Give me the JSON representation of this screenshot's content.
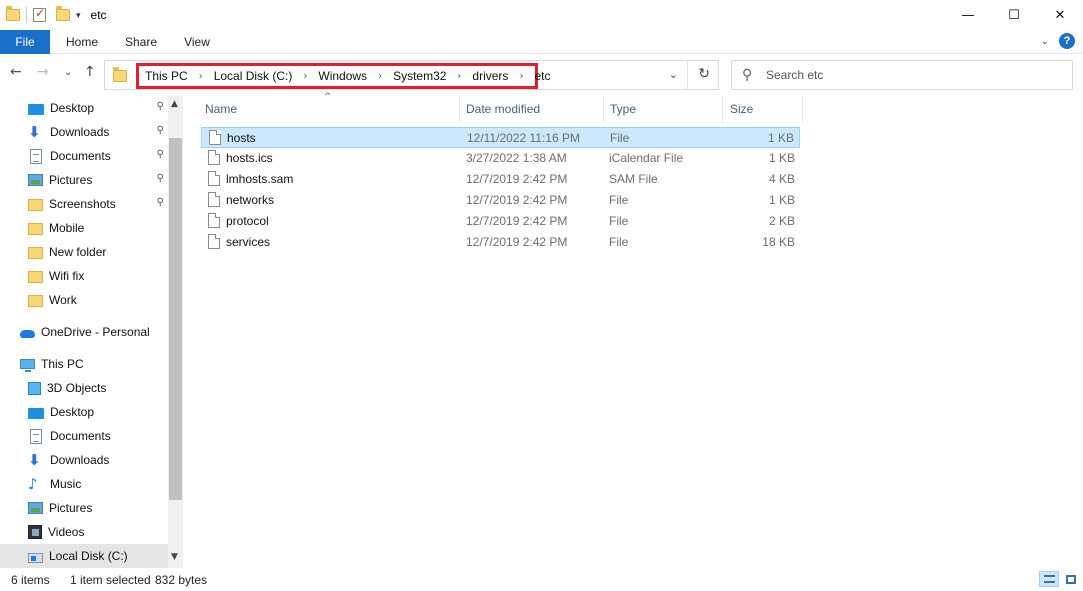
{
  "window": {
    "title": "etc",
    "controls": {
      "minimize": "—",
      "maximize": "☐",
      "close": "✕"
    }
  },
  "ribbon": {
    "tabs": [
      {
        "label": "File"
      },
      {
        "label": "Home"
      },
      {
        "label": "Share"
      },
      {
        "label": "View"
      }
    ],
    "collapse_glyph": "⌄",
    "help_glyph": "?"
  },
  "nav": {
    "back": "←",
    "forward": "→",
    "recent": "⌄",
    "up": "↑",
    "breadcrumbs": [
      "This PC",
      "Local Disk (C:)",
      "Windows",
      "System32",
      "drivers",
      "etc"
    ],
    "crumb_separator": "›",
    "address_dropdown": "⌄",
    "refresh": "↻",
    "highlight_color": "#e0202e"
  },
  "search": {
    "placeholder": "Search etc",
    "value": ""
  },
  "sidebar": {
    "items": [
      {
        "label": "Desktop",
        "icon": "desktop-icon",
        "pinned": true
      },
      {
        "label": "Downloads",
        "icon": "download-icon",
        "pinned": true
      },
      {
        "label": "Documents",
        "icon": "documents-icon",
        "pinned": true
      },
      {
        "label": "Pictures",
        "icon": "pictures-icon",
        "pinned": true
      },
      {
        "label": "Screenshots",
        "icon": "folder-icon",
        "pinned": true
      },
      {
        "label": "Mobile",
        "icon": "folder-icon",
        "pinned": false
      },
      {
        "label": "New folder",
        "icon": "folder-icon",
        "pinned": false
      },
      {
        "label": "Wifi fix",
        "icon": "folder-icon",
        "pinned": false
      },
      {
        "label": "Work",
        "icon": "folder-icon",
        "pinned": false
      },
      {
        "label": "OneDrive - Personal",
        "icon": "onedrive-icon",
        "pinned": false
      },
      {
        "label": "This PC",
        "icon": "this-pc-icon",
        "pinned": false
      },
      {
        "label": "3D Objects",
        "icon": "3d-objects-icon",
        "pinned": false
      },
      {
        "label": "Desktop",
        "icon": "desktop-icon",
        "pinned": false
      },
      {
        "label": "Documents",
        "icon": "documents-icon",
        "pinned": false
      },
      {
        "label": "Downloads",
        "icon": "download-icon",
        "pinned": false
      },
      {
        "label": "Music",
        "icon": "music-icon",
        "pinned": false
      },
      {
        "label": "Pictures",
        "icon": "pictures-icon",
        "pinned": false
      },
      {
        "label": "Videos",
        "icon": "videos-icon",
        "pinned": false
      },
      {
        "label": "Local Disk (C:)",
        "icon": "local-disk-icon",
        "pinned": false,
        "selected": true
      }
    ],
    "pin_glyph": "📌"
  },
  "columns": {
    "name": "Name",
    "date": "Date modified",
    "type": "Type",
    "size": "Size"
  },
  "files": [
    {
      "name": "hosts",
      "date": "12/11/2022 11:16 PM",
      "type": "File",
      "size": "1 KB",
      "selected": true
    },
    {
      "name": "hosts.ics",
      "date": "3/27/2022 1:38 AM",
      "type": "iCalendar File",
      "size": "1 KB"
    },
    {
      "name": "lmhosts.sam",
      "date": "12/7/2019 2:42 PM",
      "type": "SAM File",
      "size": "4 KB"
    },
    {
      "name": "networks",
      "date": "12/7/2019 2:42 PM",
      "type": "File",
      "size": "1 KB"
    },
    {
      "name": "protocol",
      "date": "12/7/2019 2:42 PM",
      "type": "File",
      "size": "2 KB"
    },
    {
      "name": "services",
      "date": "12/7/2019 2:42 PM",
      "type": "File",
      "size": "18 KB"
    }
  ],
  "status": {
    "item_count": "6 items",
    "selection": "1 item selected",
    "selection_size": "832 bytes"
  },
  "colors": {
    "accent": "#1a6fc9",
    "selection_bg": "#cce8ff",
    "selection_border": "#99d1ff"
  }
}
